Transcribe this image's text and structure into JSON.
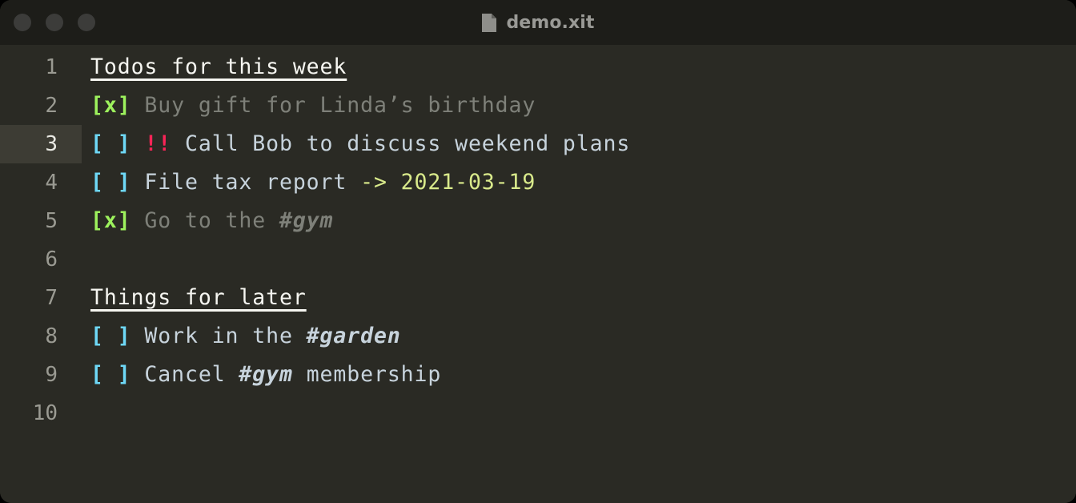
{
  "window": {
    "title": "demo.xit",
    "file_icon": "document-icon",
    "traffic_lights": [
      "close-button",
      "minimize-button",
      "zoom-button"
    ]
  },
  "editor": {
    "active_line": 3,
    "colors": {
      "background": "#2a2a24",
      "titlebar": "#1d1d19",
      "active_line": "#3d3c34",
      "gutter_text": "#9a9a92",
      "heading": "#f6f6f1",
      "checkbox_done": "#9df25d",
      "checkbox_open": "#6ed8f7",
      "priority": "#fa2457",
      "done_text": "#7e8079",
      "open_text": "#c7d3dc",
      "due_date": "#d9ea8b"
    },
    "lines": [
      {
        "number": "1",
        "tokens": [
          {
            "text": "Todos for this week",
            "style": "tok-head"
          }
        ]
      },
      {
        "number": "2",
        "tokens": [
          {
            "text": "[x]",
            "style": "tok-check-done"
          },
          {
            "text": " Buy gift for Linda’s birthday",
            "style": "tok-done-text"
          }
        ]
      },
      {
        "number": "3",
        "tokens": [
          {
            "text": "[ ]",
            "style": "tok-check-open"
          },
          {
            "text": " ",
            "style": "tok-open-text"
          },
          {
            "text": "!!",
            "style": "tok-prio"
          },
          {
            "text": " Call Bob to discuss weekend plans",
            "style": "tok-open-text"
          }
        ]
      },
      {
        "number": "4",
        "tokens": [
          {
            "text": "[ ]",
            "style": "tok-check-open"
          },
          {
            "text": " File tax report ",
            "style": "tok-open-text"
          },
          {
            "text": "-> 2021-03-19",
            "style": "tok-due"
          }
        ]
      },
      {
        "number": "5",
        "tokens": [
          {
            "text": "[x]",
            "style": "tok-check-done"
          },
          {
            "text": " Go to the ",
            "style": "tok-done-text"
          },
          {
            "text": "#gym",
            "style": "tok-tag-done"
          }
        ]
      },
      {
        "number": "6",
        "tokens": []
      },
      {
        "number": "7",
        "tokens": [
          {
            "text": "Things for later",
            "style": "tok-head"
          }
        ]
      },
      {
        "number": "8",
        "tokens": [
          {
            "text": "[ ]",
            "style": "tok-check-open"
          },
          {
            "text": " Work in the ",
            "style": "tok-open-text"
          },
          {
            "text": "#garden",
            "style": "tok-tag-open"
          }
        ]
      },
      {
        "number": "9",
        "tokens": [
          {
            "text": "[ ]",
            "style": "tok-check-open"
          },
          {
            "text": " Cancel ",
            "style": "tok-open-text"
          },
          {
            "text": "#gym",
            "style": "tok-tag-open"
          },
          {
            "text": " membership",
            "style": "tok-open-text"
          }
        ]
      },
      {
        "number": "10",
        "tokens": []
      }
    ]
  }
}
